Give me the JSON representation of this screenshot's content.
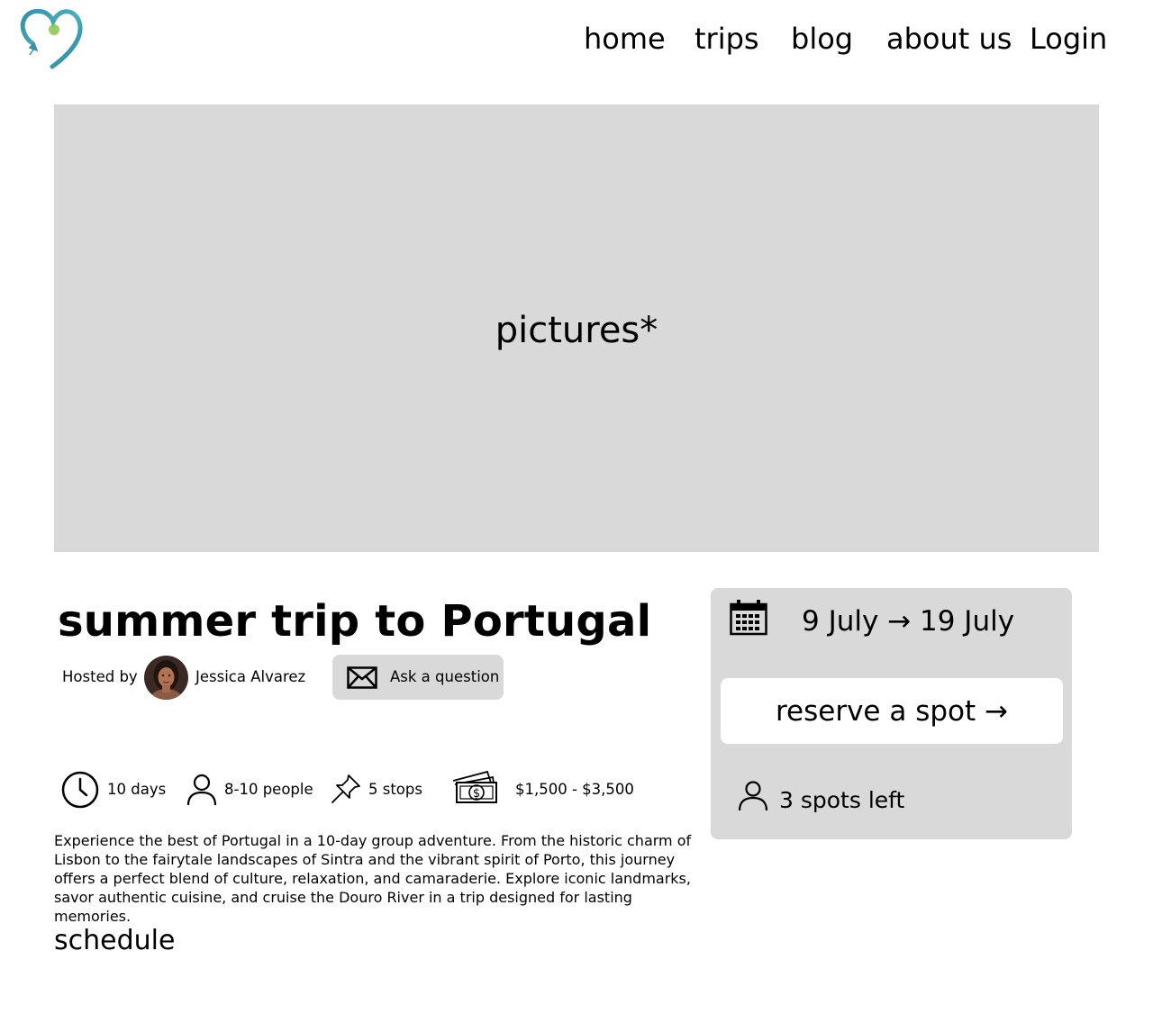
{
  "header": {
    "logo_icon": "heart-airplane-logo",
    "nav": [
      {
        "label": "home"
      },
      {
        "label": "trips"
      },
      {
        "label": "blog"
      },
      {
        "label": "about us"
      },
      {
        "label": "Login"
      }
    ]
  },
  "hero": {
    "placeholder_label": "pictures*",
    "background": "#d9d9d9"
  },
  "trip": {
    "title": "summer trip to Portugal",
    "hosted_by_label": "Hosted by",
    "host_name": "Jessica Alvarez",
    "host_avatar_icon": "host-avatar",
    "ask_button_label": "Ask a question",
    "stats": {
      "duration": "10 days",
      "group_size": "8-10 people",
      "stops": "5 stops",
      "price": "$1,500 - $3,500"
    },
    "description": "Experience the best of Portugal in a 10-day group adventure. From the historic charm of Lisbon to the fairytale landscapes of Sintra and the vibrant spirit of Porto, this journey offers a perfect blend of culture, relaxation, and camaraderie. Explore iconic landmarks, savor authentic cuisine, and cruise the Douro River in a trip designed for lasting memories.",
    "schedule_heading": "schedule"
  },
  "booking": {
    "dates": "9 July → 19 July",
    "reserve_label": "reserve a spot →",
    "spots_left": "3 spots left",
    "card_background": "#d9d9d9"
  }
}
